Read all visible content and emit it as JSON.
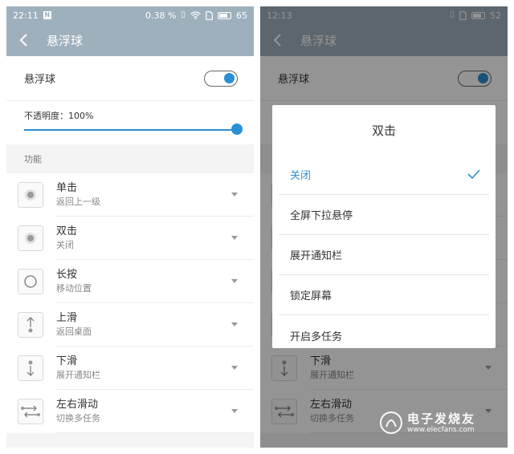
{
  "left": {
    "status": {
      "time": "22:11",
      "notif": "N",
      "speed": "0.38 %",
      "battery": "65"
    },
    "title": "悬浮球",
    "toggle_label": "悬浮球",
    "opacity_label": "不透明度：100%",
    "opacity_value": 100,
    "section": "功能",
    "items": [
      {
        "title": "单击",
        "sub": "返回上一级",
        "icon": "dot-icon"
      },
      {
        "title": "双击",
        "sub": "关闭",
        "icon": "dot-icon"
      },
      {
        "title": "长按",
        "sub": "移动位置",
        "icon": "ring-icon"
      },
      {
        "title": "上滑",
        "sub": "返回桌面",
        "icon": "arrow-up-icon"
      },
      {
        "title": "下滑",
        "sub": "展开通知栏",
        "icon": "arrow-down-icon"
      },
      {
        "title": "左右滑动",
        "sub": "切换多任务",
        "icon": "arrow-lr-icon"
      }
    ]
  },
  "right": {
    "status": {
      "time": "12:13",
      "battery": "52"
    },
    "title": "悬浮球",
    "toggle_label": "悬浮球",
    "bg_items": [
      {
        "title": "下滑",
        "sub": "展开通知栏"
      },
      {
        "title": "左右滑动",
        "sub": "切换多任务"
      }
    ],
    "dialog": {
      "title": "双击",
      "options": [
        "关闭",
        "全屏下拉悬停",
        "展开通知栏",
        "锁定屏幕",
        "开启多任务"
      ],
      "selected": 0
    }
  },
  "watermark": {
    "cn": "电子发烧友",
    "url": "www.elecfans.com"
  },
  "colors": {
    "accent": "#2b8fd6",
    "header": "#9fb0bd"
  }
}
